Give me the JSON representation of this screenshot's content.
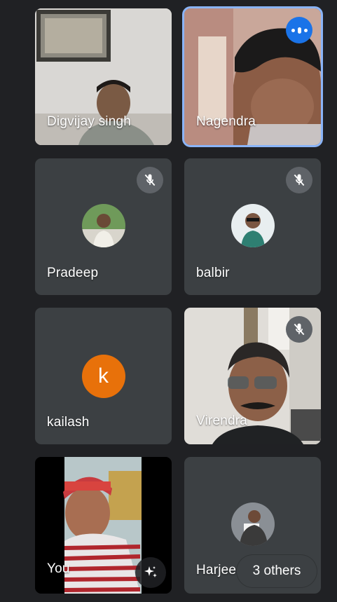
{
  "tiles": [
    {
      "name": "Digvijay singh",
      "kind": "video"
    },
    {
      "name": "Nagendra",
      "kind": "video",
      "speaking": true
    },
    {
      "name": "Pradeep",
      "kind": "avatar",
      "muted": true
    },
    {
      "name": "balbir",
      "kind": "avatar",
      "muted": true
    },
    {
      "name": "kailash",
      "kind": "letter",
      "initial": "k"
    },
    {
      "name": "Virendra",
      "kind": "video",
      "muted": true
    },
    {
      "name": "You",
      "kind": "self-video"
    },
    {
      "name": "Harjee",
      "kind": "avatar",
      "others_label": "3 others"
    }
  ],
  "icons": {
    "mute": "mic-off-icon",
    "speaking": "audio-level-icon",
    "effects": "sparkle-effects-icon"
  },
  "colors": {
    "background": "#202124",
    "tile": "#3c4043",
    "active_outline": "#8ab4f8",
    "speaking_badge": "#1a73e8",
    "letter_avatar": "#e8710a"
  }
}
